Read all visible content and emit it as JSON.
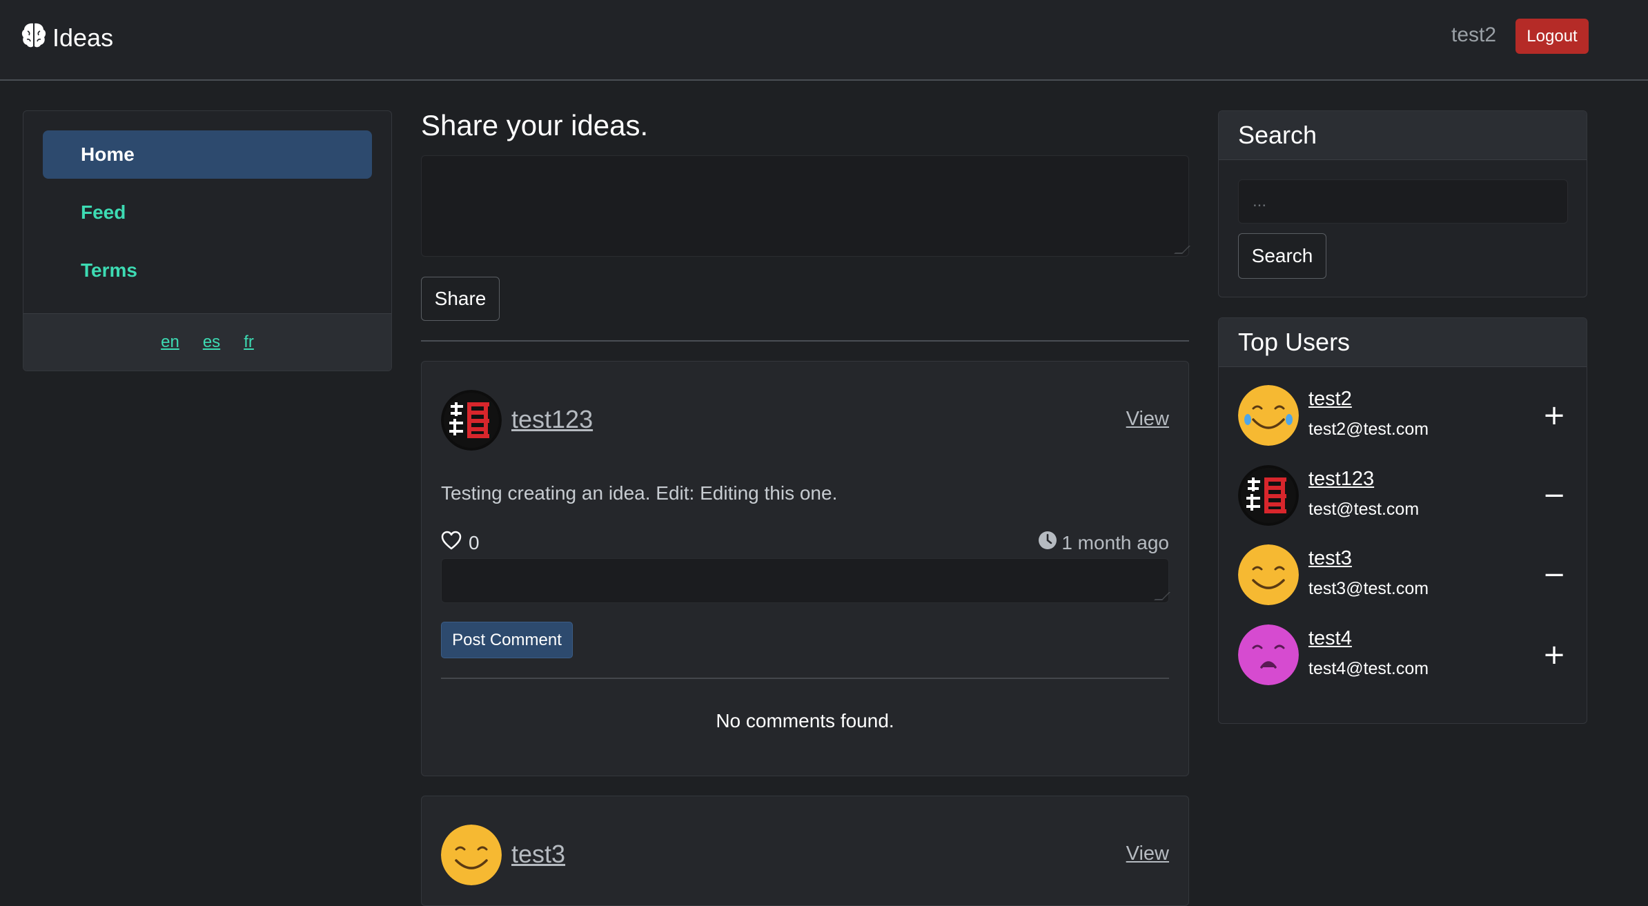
{
  "navbar": {
    "brand": "Ideas",
    "username": "test2",
    "logout_label": "Logout"
  },
  "sidebar": {
    "items": [
      {
        "label": "Home",
        "active": true
      },
      {
        "label": "Feed",
        "active": false
      },
      {
        "label": "Terms",
        "active": false
      }
    ],
    "languages": [
      "en",
      "es",
      "fr"
    ]
  },
  "main": {
    "title": "Share your ideas.",
    "idea_value": "",
    "share_label": "Share",
    "ideas": [
      {
        "author": "test123",
        "avatar": "kanji-logo",
        "view_label": "View",
        "body": "Testing creating an idea. Edit: Editing this one.",
        "likes": "0",
        "time": "1 month ago",
        "comment_value": "",
        "post_comment_label": "Post Comment",
        "no_comments": "No comments found."
      },
      {
        "author": "test3",
        "avatar": "smile-yellow",
        "view_label": "View"
      }
    ]
  },
  "search": {
    "title": "Search",
    "placeholder": "...",
    "button_label": "Search"
  },
  "top_users": {
    "title": "Top Users",
    "users": [
      {
        "name": "test2",
        "email": "test2@test.com",
        "avatar": "laugh-tears-yellow",
        "action": "+"
      },
      {
        "name": "test123",
        "email": "test@test.com",
        "avatar": "kanji-logo",
        "action": "−"
      },
      {
        "name": "test3",
        "email": "test3@test.com",
        "avatar": "smile-yellow",
        "action": "−"
      },
      {
        "name": "test4",
        "email": "test4@test.com",
        "avatar": "sad-magenta",
        "action": "+"
      }
    ]
  },
  "colors": {
    "accent": "#3ddbb3",
    "primary": "#2d4a6e",
    "danger": "#b52b27",
    "background": "#1e2023"
  }
}
